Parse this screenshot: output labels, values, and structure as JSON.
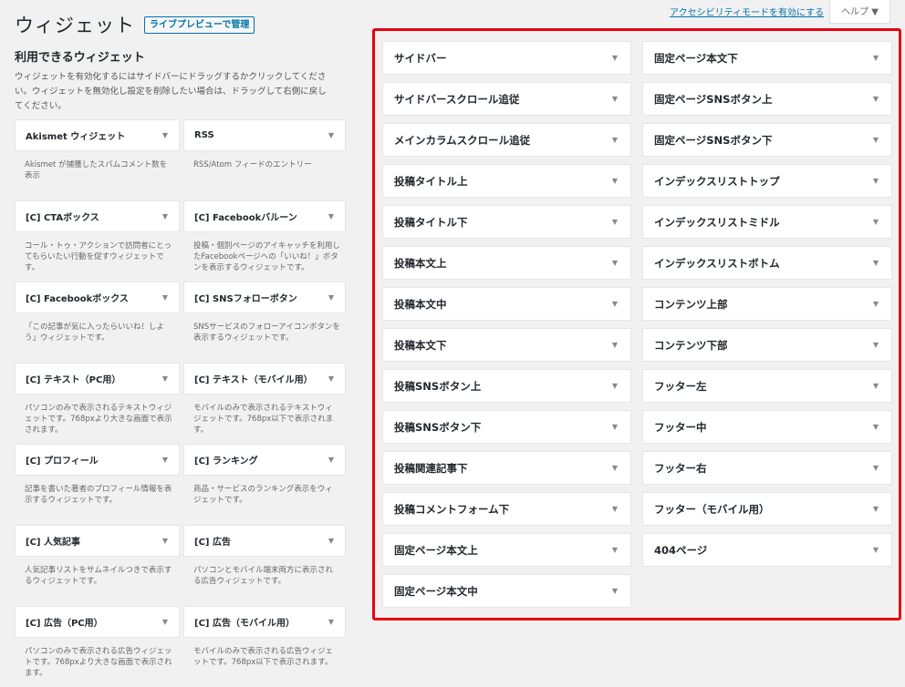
{
  "header": {
    "title": "ウィジェット",
    "live_preview": "ライブプレビューで管理"
  },
  "top": {
    "accessibility_link": "アクセシビリティモードを有効にする",
    "help": "ヘルプ ▼"
  },
  "available": {
    "title": "利用できるウィジェット",
    "description": "ウィジェットを有効化するにはサイドバーにドラッグするかクリックしてください。ウィジェットを無効化し設定を削除したい場合は、ドラッグして右側に戻してください。",
    "widgets": [
      {
        "name": "Akismet ウィジェット",
        "desc": "Akismet が捕獲したスパムコメント数を表示"
      },
      {
        "name": "RSS",
        "desc": "RSS/Atom フィードのエントリー"
      },
      {
        "name": "[C] CTAボックス",
        "desc": "コール・トゥ・アクションで訪問者にとってもらいたい行動を促すウィジェットです。"
      },
      {
        "name": "[C] Facebookバルーン",
        "desc": "投稿・個別ページのアイキャッチを利用したFacebookページへの「いいね！」ボタンを表示するウィジェットです。"
      },
      {
        "name": "[C] Facebookボックス",
        "desc": "「この記事が気に入ったらいいね！しよう」ウィジェットです。"
      },
      {
        "name": "[C] SNSフォローボタン",
        "desc": "SNSサービスのフォローアイコンボタンを表示するウィジェットです。"
      },
      {
        "name": "[C] テキスト（PC用）",
        "desc": "パソコンのみで表示されるテキストウィジェットです。768pxより大きな画面で表示されます。"
      },
      {
        "name": "[C] テキスト（モバイル用）",
        "desc": "モバイルのみで表示されるテキストウィジェットです。768px以下で表示されます。"
      },
      {
        "name": "[C] プロフィール",
        "desc": "記事を書いた著者のプロフィール情報を表示するウィジェットです。"
      },
      {
        "name": "[C] ランキング",
        "desc": "商品・サービスのランキング表示をウィジェットです。"
      },
      {
        "name": "[C] 人気記事",
        "desc": "人気記事リストをサムネイルつきで表示するウィジェットです。"
      },
      {
        "name": "[C] 広告",
        "desc": "パソコンとモバイル端末両方に表示される広告ウィジェットです。"
      },
      {
        "name": "[C] 広告（PC用）",
        "desc": "パソコンのみで表示される広告ウィジェットです。768pxより大きな画面で表示されます。"
      },
      {
        "name": "[C] 広告（モバイル用）",
        "desc": "モバイルのみで表示される広告ウィジェットです。768px以下で表示されます。"
      }
    ]
  },
  "areas": {
    "left": [
      "サイドバー",
      "サイドバースクロール追従",
      "メインカラムスクロール追従",
      "投稿タイトル上",
      "投稿タイトル下",
      "投稿本文上",
      "投稿本文中",
      "投稿本文下",
      "投稿SNSボタン上",
      "投稿SNSボタン下",
      "投稿関連記事下",
      "投稿コメントフォーム下",
      "固定ページ本文上",
      "固定ページ本文中"
    ],
    "right": [
      "固定ページ本文下",
      "固定ページSNSボタン上",
      "固定ページSNSボタン下",
      "インデックスリストトップ",
      "インデックスリストミドル",
      "インデックスリストボトム",
      "コンテンツ上部",
      "コンテンツ下部",
      "フッター左",
      "フッター中",
      "フッター右",
      "フッター（モバイル用）",
      "404ページ"
    ]
  },
  "colors": {
    "highlight_border": "#e60012",
    "link": "#0073aa"
  },
  "icons": {
    "toggle": "chevron-down-icon"
  }
}
